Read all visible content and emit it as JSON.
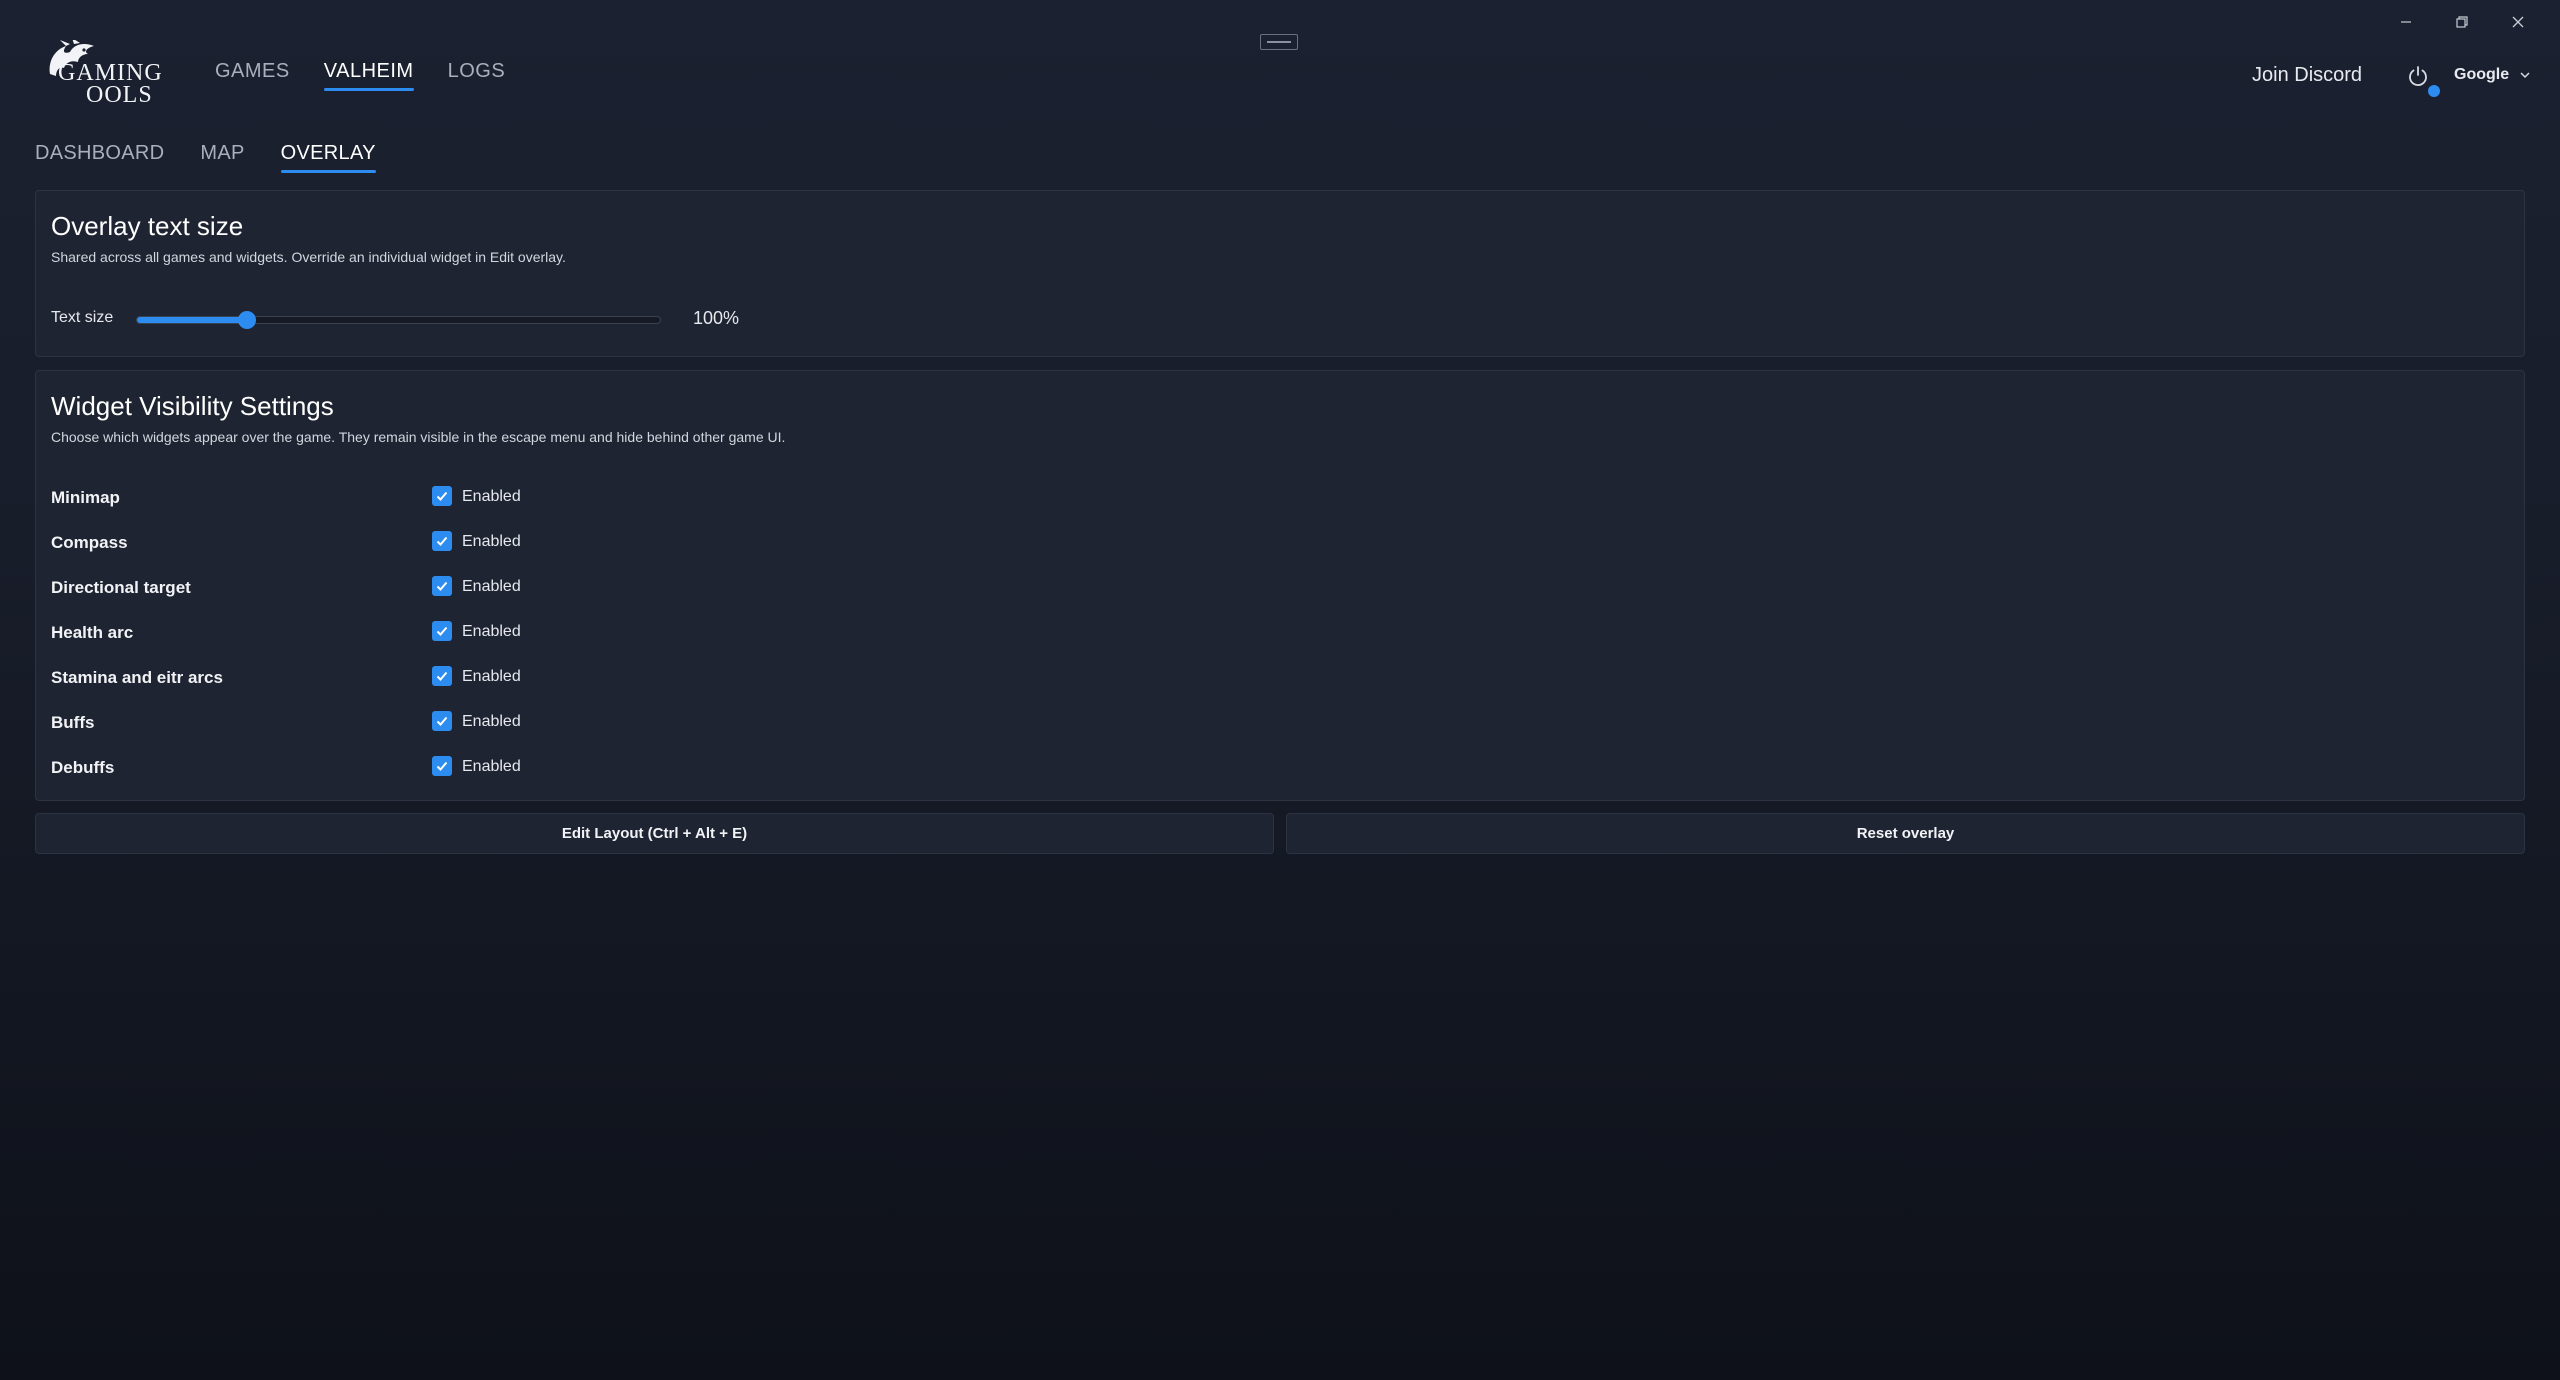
{
  "app": {
    "logo_line1": "GAMING",
    "logo_line2": "OOLS"
  },
  "main_nav": {
    "items": [
      {
        "label": "GAMES",
        "active": false
      },
      {
        "label": "VALHEIM",
        "active": true
      },
      {
        "label": "LOGS",
        "active": false
      }
    ]
  },
  "header": {
    "join_discord": "Join Discord",
    "account_name": "Google"
  },
  "sub_nav": {
    "items": [
      {
        "label": "DASHBOARD",
        "active": false
      },
      {
        "label": "MAP",
        "active": false
      },
      {
        "label": "OVERLAY",
        "active": true
      }
    ]
  },
  "text_size_panel": {
    "title": "Overlay text size",
    "description": "Shared across all games and widgets. Override an individual widget in Edit overlay.",
    "slider_label": "Text size",
    "slider_fraction": 0.21,
    "value_display": "100%"
  },
  "widgets_panel": {
    "title": "Widget Visibility Settings",
    "description": "Choose which widgets appear over the game. They remain visible in the escape menu and hide behind other game UI.",
    "rows": [
      {
        "name": "Minimap",
        "status": "Enabled",
        "checked": true
      },
      {
        "name": "Compass",
        "status": "Enabled",
        "checked": true
      },
      {
        "name": "Directional target",
        "status": "Enabled",
        "checked": true
      },
      {
        "name": "Health arc",
        "status": "Enabled",
        "checked": true
      },
      {
        "name": "Stamina and eitr arcs",
        "status": "Enabled",
        "checked": true
      },
      {
        "name": "Buffs",
        "status": "Enabled",
        "checked": true
      },
      {
        "name": "Debuffs",
        "status": "Enabled",
        "checked": true
      }
    ]
  },
  "actions": {
    "edit_layout": "Edit Layout (Ctrl + Alt + E)",
    "reset_overlay": "Reset overlay"
  },
  "colors": {
    "accent": "#2d8cf0",
    "panel": "#1e2431",
    "background": "#181d2a"
  },
  "icons": {
    "window": [
      "minimize-icon",
      "restore-icon",
      "close-icon"
    ],
    "power": "power-icon",
    "dropdown": "chevron-down-icon",
    "check": "check-icon"
  }
}
